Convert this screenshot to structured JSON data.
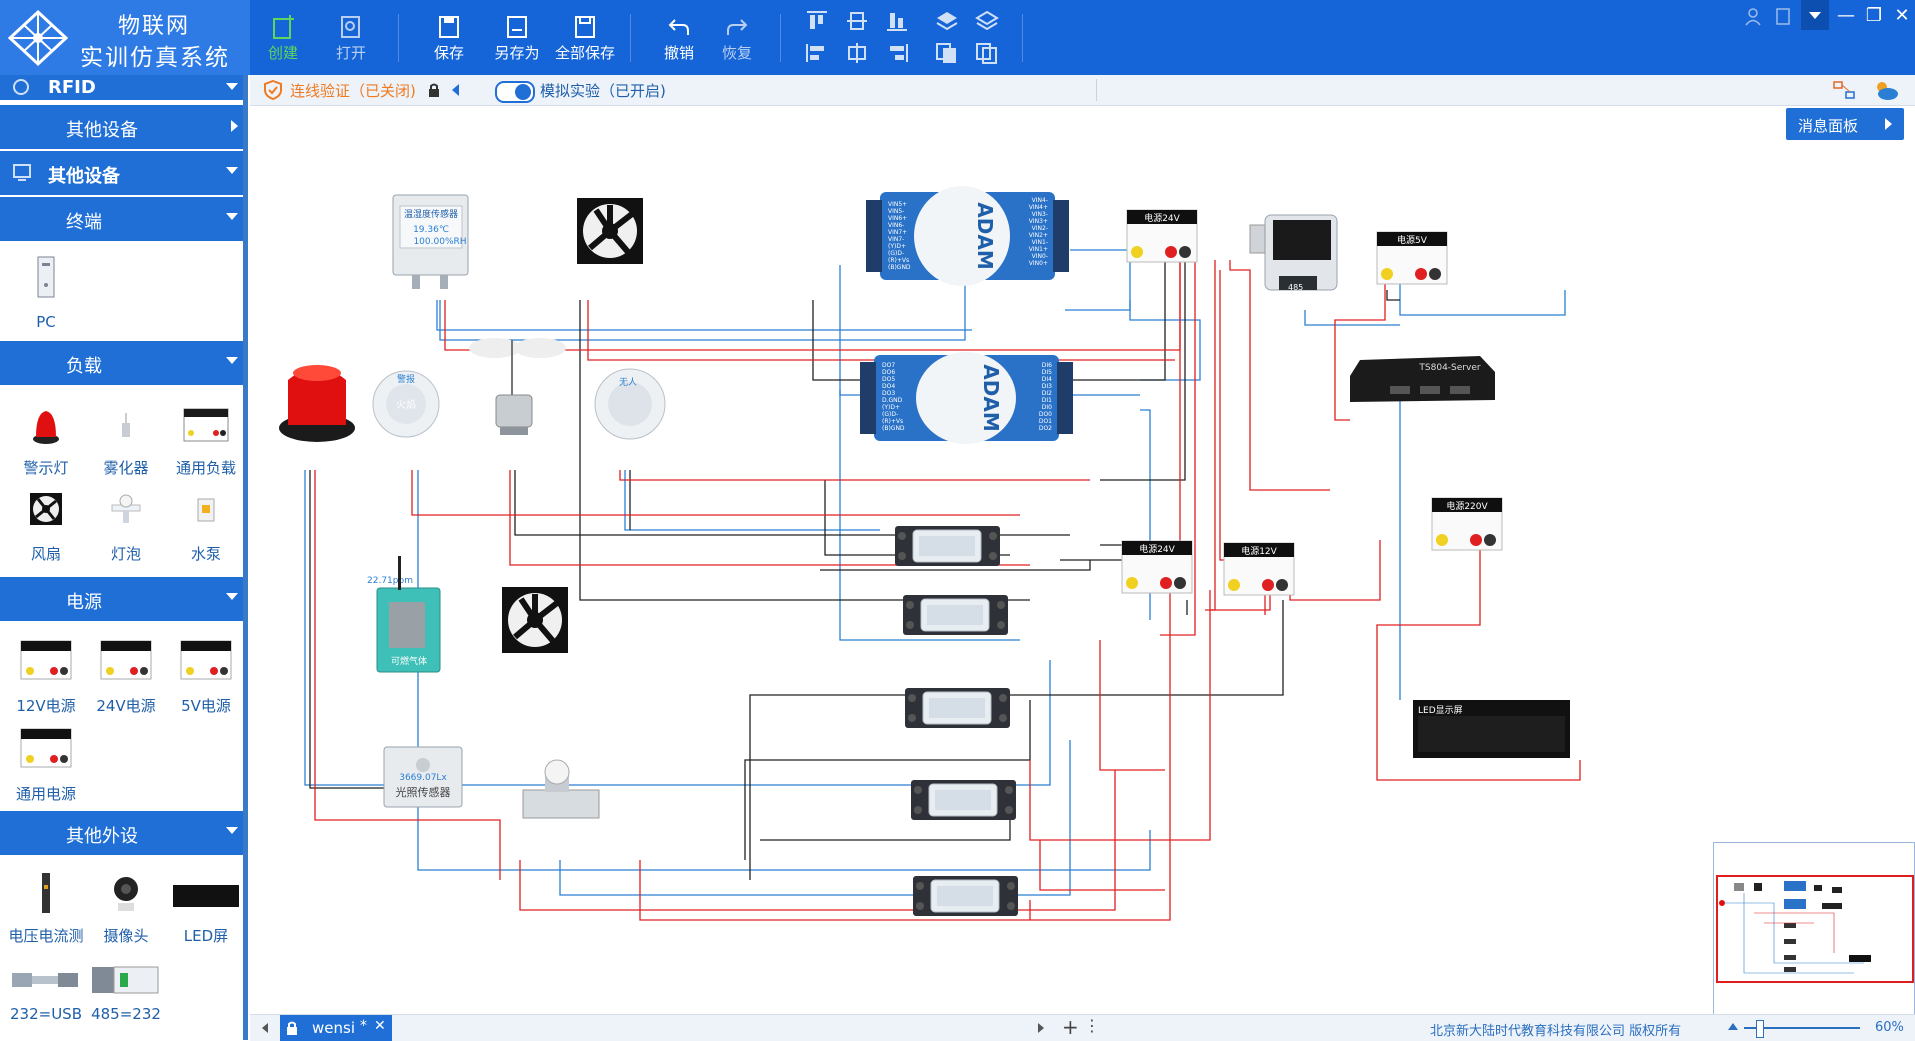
{
  "app": {
    "title_line1": "物联网",
    "title_line2": "实训仿真系统"
  },
  "toolbar": {
    "create": "创建",
    "open": "打开",
    "save": "保存",
    "save_as": "另存为",
    "save_all": "全部保存",
    "undo": "撤销",
    "redo": "恢复"
  },
  "tabbar": {
    "verify_label": "连线验证（已关闭)",
    "sim_label": "模拟实验（已开启)"
  },
  "sidebar": {
    "rfid": "RFID",
    "other_devices_1": "其他设备",
    "other_devices_2": "其他设备",
    "terminal": {
      "title": "终端",
      "items": [
        "PC"
      ]
    },
    "load": {
      "title": "负载",
      "items": [
        "警示灯",
        "雾化器",
        "通用负载",
        "风扇",
        "灯泡",
        "水泵"
      ]
    },
    "power": {
      "title": "电源",
      "items": [
        "12V电源",
        "24V电源",
        "5V电源",
        "通用电源"
      ]
    },
    "peripherals": {
      "title": "其他外设",
      "items": [
        "电压电流测",
        "摄像头",
        "LED屏",
        "232=USB",
        "485=232"
      ]
    }
  },
  "canvas": {
    "message_panel": "消息面板",
    "temp_sensor": {
      "title": "温湿度传感器",
      "temp": "19.36℃",
      "hum": "100.00%RH"
    },
    "light_sensor": {
      "value": "3669.07Lx",
      "title": "光照传感器"
    },
    "gas_sensor": {
      "value": "22.71ppm",
      "title": "可燃气体"
    },
    "flame_badge": "警报",
    "flame_label": "火焰",
    "person_badge": "无人",
    "adam_brand": "ADAM",
    "adam1_left_pins": [
      "VIN5+",
      "VIN5-",
      "VIN6+",
      "VIN6-",
      "VIN7+",
      "VIN7-",
      "(Y)D+",
      "(G)D-",
      "(R)+Vs",
      "(B)GND"
    ],
    "adam1_right_pins": [
      "VIN4-",
      "VIN4+",
      "VIN3-",
      "VIN3+",
      "VIN2-",
      "VIN2+",
      "VIN1-",
      "VIN1+",
      "VIN0-",
      "VIN0+"
    ],
    "adam2_left_pins": [
      "DO7",
      "DO6",
      "DO5",
      "DO4",
      "DO3",
      "D.GND",
      "(Y)D+",
      "(G)D-",
      "(R)+Vs",
      "(B)GND"
    ],
    "adam2_right_pins": [
      "DI6",
      "DI5",
      "DI4",
      "DI3",
      "DI2",
      "DI1",
      "DI0",
      "DO0",
      "DO1",
      "DO2"
    ],
    "psu_24v_a": "电源24V",
    "psu_24v_b": "电源24V",
    "psu_12v": "电源12V",
    "psu_5v": "电源5V",
    "psu_220v": "电源220V",
    "terminal_server": "TS804-Server",
    "led_screen": "LED显示屏",
    "display_485": "485"
  },
  "bottom": {
    "tab_name": "wensi",
    "tab_mark": "*",
    "copyright": "北京新大陆时代教育科技有限公司 版权所有",
    "zoom": "60%"
  },
  "colors": {
    "header": "#1565d8",
    "sidebar_head": "#1f6fd6",
    "wire_red": "#e02020",
    "wire_blue": "#2a7fd4",
    "wire_black": "#222222"
  }
}
